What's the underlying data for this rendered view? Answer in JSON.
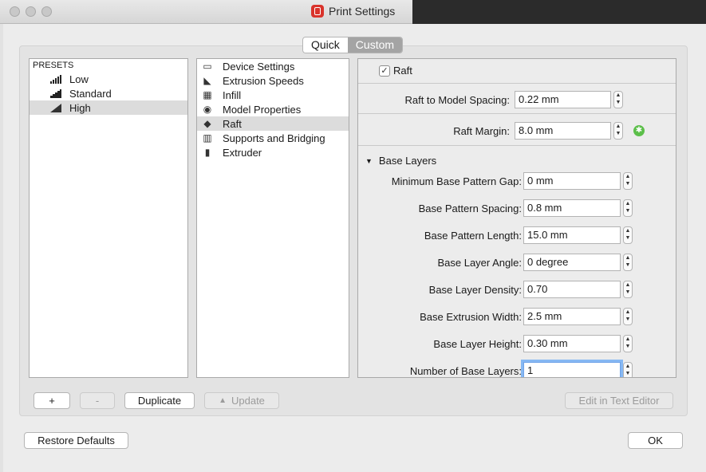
{
  "window": {
    "title": "Print Settings"
  },
  "tabs": [
    {
      "label": "Quick",
      "active": false
    },
    {
      "label": "Custom",
      "active": true
    }
  ],
  "presets": {
    "header": "PRESETS",
    "items": [
      {
        "label": "Low",
        "icon": "low-quality-icon"
      },
      {
        "label": "Standard",
        "icon": "standard-quality-icon"
      },
      {
        "label": "High",
        "icon": "high-quality-icon",
        "selected": true
      }
    ]
  },
  "categories": [
    {
      "label": "Device Settings",
      "icon": "window-icon"
    },
    {
      "label": "Extrusion Speeds",
      "icon": "rabbit-icon"
    },
    {
      "label": "Infill",
      "icon": "cube-icon"
    },
    {
      "label": "Model Properties",
      "icon": "eye-icon"
    },
    {
      "label": "Raft",
      "icon": "layers-icon",
      "selected": true
    },
    {
      "label": "Supports and Bridging",
      "icon": "supports-icon"
    },
    {
      "label": "Extruder",
      "icon": "extruder-icon"
    }
  ],
  "raft": {
    "enabled_label": "Raft",
    "enabled": true,
    "model_spacing": {
      "label": "Raft to Model Spacing:",
      "value": "0.22 mm"
    },
    "margin": {
      "label": "Raft Margin:",
      "value": "8.0 mm"
    },
    "base_layers": {
      "title": "Base Layers",
      "fields": [
        {
          "label": "Minimum Base Pattern Gap:",
          "value": "0 mm"
        },
        {
          "label": "Base Pattern Spacing:",
          "value": "0.8 mm"
        },
        {
          "label": "Base Pattern Length:",
          "value": "15.0 mm"
        },
        {
          "label": "Base Layer Angle:",
          "value": "0 degree"
        },
        {
          "label": "Base Layer Density:",
          "value": "0.70"
        },
        {
          "label": "Base Extrusion Width:",
          "value": "2.5 mm"
        },
        {
          "label": "Base Layer Height:",
          "value": "0.30 mm"
        },
        {
          "label": "Number of Base Layers:",
          "value": "1"
        }
      ]
    }
  },
  "buttons": {
    "add": "+",
    "remove": "-",
    "duplicate": "Duplicate",
    "update": "Update",
    "edit_text": "Edit in Text Editor",
    "restore": "Restore Defaults",
    "ok": "OK"
  },
  "colors": {
    "selection": "#dcdcdc",
    "segment_active": "#a4a4a4",
    "focus_ring": "#86b8f3",
    "add_button_green": "#5cbf4a"
  }
}
